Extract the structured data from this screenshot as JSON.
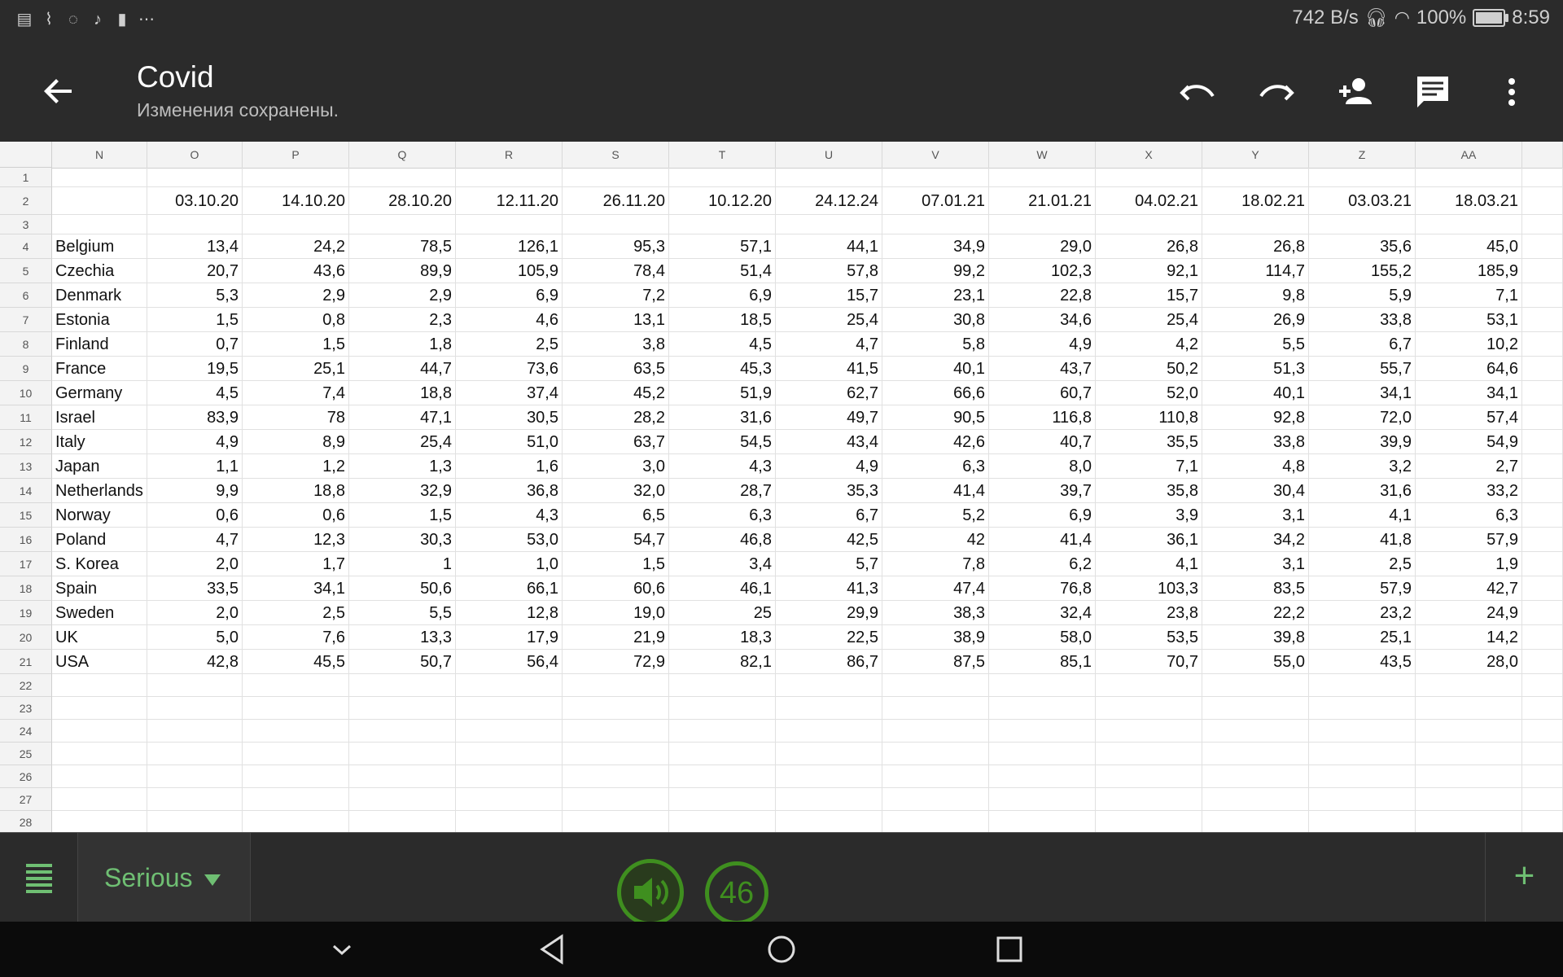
{
  "status_bar": {
    "net_speed": "742 B/s",
    "battery": "100%",
    "time": "8:59",
    "left_icons": [
      "notepad-icon",
      "activity-icon",
      "check-circle-icon",
      "volume-icon",
      "battery-saver-icon",
      "more-dots-icon"
    ]
  },
  "app_bar": {
    "title": "Covid",
    "subtitle": "Изменения сохранены."
  },
  "sheet": {
    "columns": [
      "N",
      "O",
      "P",
      "Q",
      "R",
      "S",
      "T",
      "U",
      "V",
      "W",
      "X",
      "Y",
      "Z",
      "AA"
    ],
    "row_numbers": [
      "1",
      "2",
      "3",
      "4",
      "5",
      "6",
      "7",
      "8",
      "9",
      "10",
      "11",
      "12",
      "13",
      "14",
      "15",
      "16",
      "17",
      "18",
      "19",
      "20",
      "21",
      "22",
      "23",
      "24",
      "25",
      "26",
      "27",
      "28"
    ],
    "dates": [
      "03.10.20",
      "14.10.20",
      "28.10.20",
      "12.11.20",
      "26.11.20",
      "10.12.20",
      "24.12.24",
      "07.01.21",
      "21.01.21",
      "04.02.21",
      "18.02.21",
      "03.03.21",
      "18.03.21"
    ],
    "rows": [
      {
        "name": "Belgium",
        "values": [
          "13,4",
          "24,2",
          "78,5",
          "126,1",
          "95,3",
          "57,1",
          "44,1",
          "34,9",
          "29,0",
          "26,8",
          "26,8",
          "35,6",
          "45,0"
        ]
      },
      {
        "name": "Czechia",
        "values": [
          "20,7",
          "43,6",
          "89,9",
          "105,9",
          "78,4",
          "51,4",
          "57,8",
          "99,2",
          "102,3",
          "92,1",
          "114,7",
          "155,2",
          "185,9"
        ]
      },
      {
        "name": "Denmark",
        "values": [
          "5,3",
          "2,9",
          "2,9",
          "6,9",
          "7,2",
          "6,9",
          "15,7",
          "23,1",
          "22,8",
          "15,7",
          "9,8",
          "5,9",
          "7,1"
        ]
      },
      {
        "name": "Estonia",
        "values": [
          "1,5",
          "0,8",
          "2,3",
          "4,6",
          "13,1",
          "18,5",
          "25,4",
          "30,8",
          "34,6",
          "25,4",
          "26,9",
          "33,8",
          "53,1"
        ]
      },
      {
        "name": "Finland",
        "values": [
          "0,7",
          "1,5",
          "1,8",
          "2,5",
          "3,8",
          "4,5",
          "4,7",
          "5,8",
          "4,9",
          "4,2",
          "5,5",
          "6,7",
          "10,2"
        ]
      },
      {
        "name": "France",
        "values": [
          "19,5",
          "25,1",
          "44,7",
          "73,6",
          "63,5",
          "45,3",
          "41,5",
          "40,1",
          "43,7",
          "50,2",
          "51,3",
          "55,7",
          "64,6"
        ]
      },
      {
        "name": "Germany",
        "values": [
          "4,5",
          "7,4",
          "18,8",
          "37,4",
          "45,2",
          "51,9",
          "62,7",
          "66,6",
          "60,7",
          "52,0",
          "40,1",
          "34,1",
          "34,1"
        ]
      },
      {
        "name": "Israel",
        "values": [
          "83,9",
          "78",
          "47,1",
          "30,5",
          "28,2",
          "31,6",
          "49,7",
          "90,5",
          "116,8",
          "110,8",
          "92,8",
          "72,0",
          "57,4"
        ]
      },
      {
        "name": "Italy",
        "values": [
          "4,9",
          "8,9",
          "25,4",
          "51,0",
          "63,7",
          "54,5",
          "43,4",
          "42,6",
          "40,7",
          "35,5",
          "33,8",
          "39,9",
          "54,9"
        ]
      },
      {
        "name": "Japan",
        "values": [
          "1,1",
          "1,2",
          "1,3",
          "1,6",
          "3,0",
          "4,3",
          "4,9",
          "6,3",
          "8,0",
          "7,1",
          "4,8",
          "3,2",
          "2,7"
        ]
      },
      {
        "name": "Netherlands",
        "values": [
          "9,9",
          "18,8",
          "32,9",
          "36,8",
          "32,0",
          "28,7",
          "35,3",
          "41,4",
          "39,7",
          "35,8",
          "30,4",
          "31,6",
          "33,2"
        ]
      },
      {
        "name": "Norway",
        "values": [
          "0,6",
          "0,6",
          "1,5",
          "4,3",
          "6,5",
          "6,3",
          "6,7",
          "5,2",
          "6,9",
          "3,9",
          "3,1",
          "4,1",
          "6,3"
        ]
      },
      {
        "name": "Poland",
        "values": [
          "4,7",
          "12,3",
          "30,3",
          "53,0",
          "54,7",
          "46,8",
          "42,5",
          "42",
          "41,4",
          "36,1",
          "34,2",
          "41,8",
          "57,9"
        ]
      },
      {
        "name": "S. Korea",
        "values": [
          "2,0",
          "1,7",
          "1",
          "1,0",
          "1,5",
          "3,4",
          "5,7",
          "7,8",
          "6,2",
          "4,1",
          "3,1",
          "2,5",
          "1,9"
        ]
      },
      {
        "name": "Spain",
        "values": [
          "33,5",
          "34,1",
          "50,6",
          "66,1",
          "60,6",
          "46,1",
          "41,3",
          "47,4",
          "76,8",
          "103,3",
          "83,5",
          "57,9",
          "42,7"
        ]
      },
      {
        "name": "Sweden",
        "values": [
          "2,0",
          "2,5",
          "5,5",
          "12,8",
          "19,0",
          "25",
          "29,9",
          "38,3",
          "32,4",
          "23,8",
          "22,2",
          "23,2",
          "24,9"
        ]
      },
      {
        "name": "UK",
        "values": [
          "5,0",
          "7,6",
          "13,3",
          "17,9",
          "21,9",
          "18,3",
          "22,5",
          "38,9",
          "58,0",
          "53,5",
          "39,8",
          "25,1",
          "14,2"
        ]
      },
      {
        "name": "USA",
        "values": [
          "42,8",
          "45,5",
          "50,7",
          "56,4",
          "72,9",
          "82,1",
          "86,7",
          "87,5",
          "85,1",
          "70,7",
          "55,0",
          "43,5",
          "28,0"
        ]
      }
    ]
  },
  "bottom_bar": {
    "sheet_tab": "Serious",
    "add_label": "+",
    "overlay_count": "46"
  },
  "colors": {
    "appbar_bg": "#2b2b2b",
    "accent_green": "#6fbf73",
    "overlay_green": "#3f8f1f"
  }
}
